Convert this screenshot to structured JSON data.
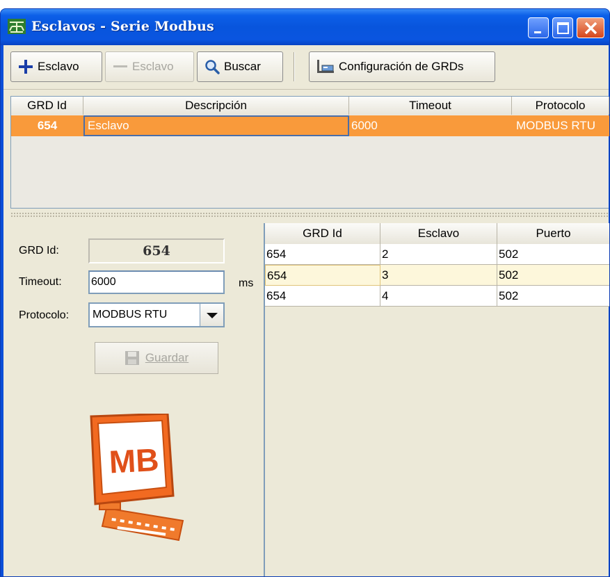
{
  "window": {
    "title": "Esclavos - Serie Modbus"
  },
  "toolbar": {
    "add_label": "Esclavo",
    "remove_label": "Esclavo",
    "search_label": "Buscar",
    "config_label": "Configuración de GRDs"
  },
  "top_grid": {
    "columns": [
      "GRD Id",
      "Descripción",
      "Timeout",
      "Protocolo"
    ],
    "rows": [
      {
        "grd_id": "654",
        "descripcion": "Esclavo",
        "timeout": "6000",
        "protocolo": "MODBUS RTU"
      }
    ],
    "selected_row_color": "#f99a3b"
  },
  "form": {
    "grd_id_label": "GRD Id:",
    "grd_id_value": "654",
    "timeout_label": "Timeout:",
    "timeout_value": "6000",
    "timeout_unit": "ms",
    "protocol_label": "Protocolo:",
    "protocol_value": "MODBUS RTU",
    "save_label": "Guardar"
  },
  "detail_grid": {
    "columns": [
      "GRD Id",
      "Esclavo",
      "Puerto"
    ],
    "rows": [
      {
        "grd_id": "654",
        "esclavo": "2",
        "puerto": "502"
      },
      {
        "grd_id": "654",
        "esclavo": "3",
        "puerto": "502"
      },
      {
        "grd_id": "654",
        "esclavo": "4",
        "puerto": "502"
      }
    ]
  },
  "logo": {
    "text": "MB",
    "color": "#f26a21"
  },
  "icons": [
    "app-icon",
    "minimize-icon",
    "maximize-icon",
    "close-icon",
    "plus-icon",
    "minus-icon",
    "search-icon",
    "config-icon",
    "dropdown-arrow-icon",
    "save-disk-icon",
    "mb-computer-icon"
  ]
}
